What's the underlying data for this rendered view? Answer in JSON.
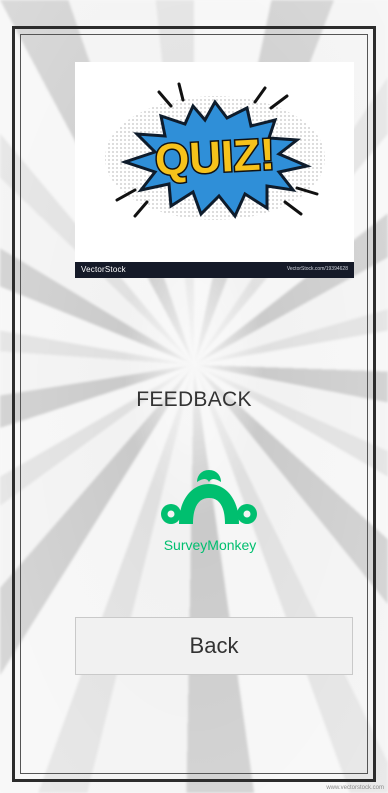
{
  "quiz_image": {
    "burst_text": "QUIZ!",
    "watermark_logo": "VectorStock",
    "watermark_url": "VectorStock.com/19394628"
  },
  "feedback": {
    "label": "FEEDBACK"
  },
  "survey": {
    "brand_name": "SurveyMonkey"
  },
  "actions": {
    "back_label": "Back"
  },
  "footer": {
    "corner_mark": "www.vectorstock.com"
  },
  "colors": {
    "accent_green": "#00bf6f",
    "quiz_yellow": "#f6c21b",
    "quiz_blue": "#2f8fd8",
    "frame": "#2c2c2c"
  }
}
